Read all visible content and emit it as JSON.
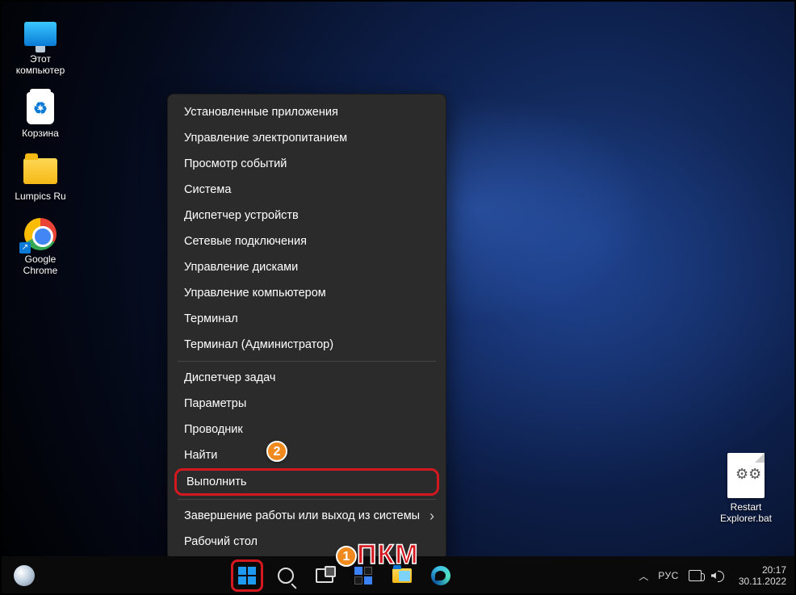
{
  "desktop_icons": [
    {
      "id": "this-pc",
      "label": "Этот\nкомпьютер"
    },
    {
      "id": "recycle-bin",
      "label": "Корзина"
    },
    {
      "id": "lumpics-folder",
      "label": "Lumpics Ru"
    },
    {
      "id": "chrome",
      "label": "Google\nChrome"
    }
  ],
  "desktop_file": {
    "label": "Restart\nExplorer.bat"
  },
  "context_menu": {
    "groups": [
      [
        "Установленные приложения",
        "Управление электропитанием",
        "Просмотр событий",
        "Система",
        "Диспетчер устройств",
        "Сетевые подключения",
        "Управление дисками",
        "Управление компьютером",
        "Терминал",
        "Терминал (Администратор)"
      ],
      [
        "Диспетчер задач",
        "Параметры",
        "Проводник",
        "Найти",
        "Выполнить"
      ],
      [
        "Завершение работы или выход из системы",
        "Рабочий стол"
      ]
    ],
    "submenu_items": [
      "Завершение работы или выход из системы"
    ],
    "highlighted_item": "Выполнить"
  },
  "annotations": {
    "badge1": "1",
    "badge2": "2",
    "text": "ПКМ"
  },
  "taskbar": {
    "buttons": [
      "start",
      "search",
      "task-view",
      "widgets",
      "file-explorer",
      "edge"
    ],
    "tray": {
      "lang": "РУС",
      "time": "20:17",
      "date": "30.11.2022"
    }
  }
}
